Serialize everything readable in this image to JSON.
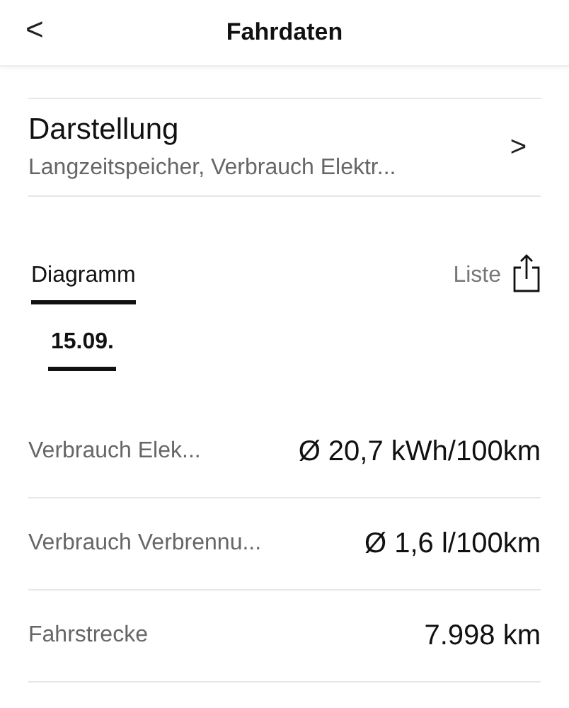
{
  "header": {
    "back": "<",
    "title": "Fahrdaten"
  },
  "display": {
    "title": "Darstellung",
    "subtitle": "Langzeitspeicher, Verbrauch Elektr...",
    "chevron": ">"
  },
  "tabs": [
    {
      "label": "Diagramm",
      "selected": true
    },
    {
      "label": "Liste",
      "selected": false
    }
  ],
  "dates": [
    {
      "label": "15.09.",
      "selected": true
    }
  ],
  "stats": [
    {
      "label": "Verbrauch Elek...",
      "value": "Ø 20,7 kWh/100km"
    },
    {
      "label": "Verbrauch Verbrennu...",
      "value": "Ø 1,6 l/100km"
    },
    {
      "label": "Fahrstrecke",
      "value": "7.998 km"
    }
  ]
}
